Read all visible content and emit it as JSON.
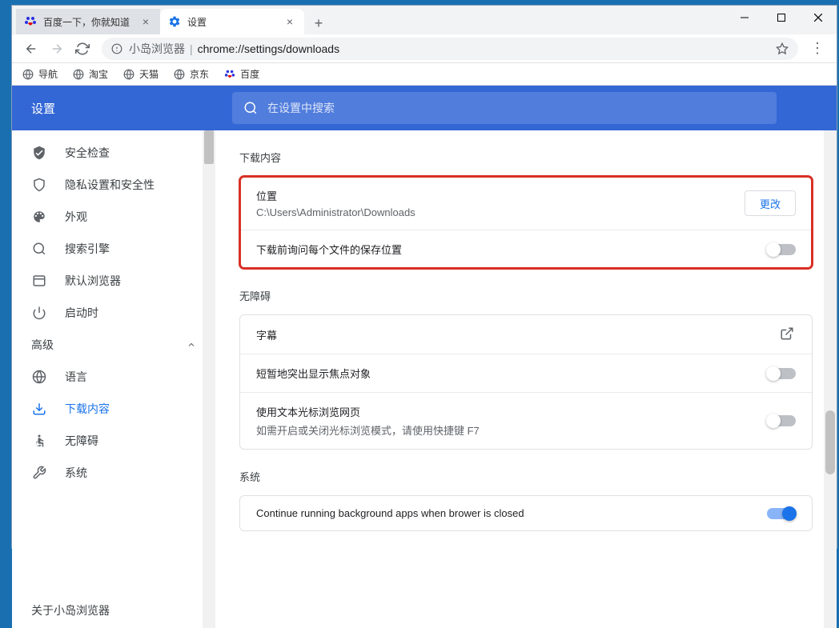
{
  "window": {
    "tabs": [
      {
        "title": "百度一下，你就知道",
        "active": false
      },
      {
        "title": "设置",
        "active": true
      }
    ],
    "omnibox": {
      "host": "小岛浏览器",
      "path": "chrome://settings/downloads"
    }
  },
  "bookmarks": [
    {
      "label": "导航"
    },
    {
      "label": "淘宝"
    },
    {
      "label": "天猫"
    },
    {
      "label": "京东"
    },
    {
      "label": "百度"
    }
  ],
  "header": {
    "title": "设置",
    "search_placeholder": "在设置中搜索"
  },
  "sidebar": {
    "items": [
      {
        "label": "安全检查"
      },
      {
        "label": "隐私设置和安全性"
      },
      {
        "label": "外观"
      },
      {
        "label": "搜索引擎"
      },
      {
        "label": "默认浏览器"
      },
      {
        "label": "启动时"
      }
    ],
    "group": "高级",
    "sub_items": [
      {
        "label": "语言"
      },
      {
        "label": "下载内容",
        "active": true
      },
      {
        "label": "无障碍"
      },
      {
        "label": "系统"
      }
    ],
    "footer": "关于小岛浏览器"
  },
  "main": {
    "downloads": {
      "section_title": "下载内容",
      "location_label": "位置",
      "location_path": "C:\\Users\\Administrator\\Downloads",
      "change_button": "更改",
      "ask_location": "下载前询问每个文件的保存位置"
    },
    "accessibility": {
      "section_title": "无障碍",
      "captions": "字幕",
      "highlight_focus": "短暂地突出显示焦点对象",
      "caret_label": "使用文本光标浏览网页",
      "caret_sub": "如需开启或关闭光标浏览模式，请使用快捷键 F7"
    },
    "system": {
      "section_title": "系统",
      "continue_running": "Continue running background apps when brower is closed"
    }
  }
}
